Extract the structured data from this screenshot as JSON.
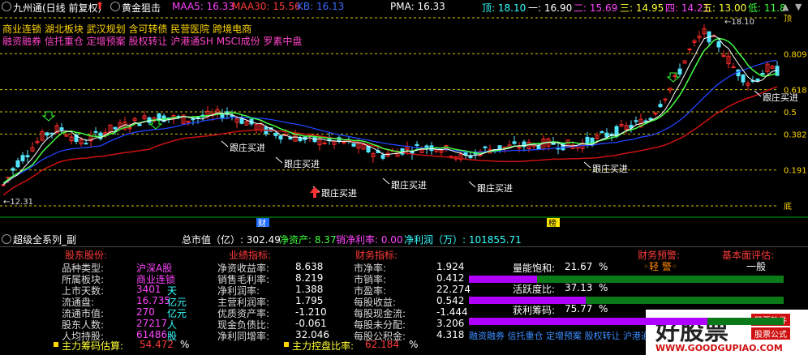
{
  "header": {
    "title": "九州通(日线 前复权)",
    "strategy": "黄金狙击",
    "ma5": "MAA5: 16.33",
    "ma30": "MAA30: 15.56",
    "kb": "KB: 16.13",
    "pma": "PMA: 16.33",
    "top_label": "顶: 18.10",
    "one_label": "一: 16.90",
    "two_label": "二: 15.69",
    "three_label": "三: 14.95",
    "four_label": "四: 14.21",
    "five_label": "五: 13.00",
    "low_label": "低: 11.8"
  },
  "concepts": {
    "line1": "商业连锁 湖北板块 武汉规划 含可转债 民营医院 跨境电商",
    "line2": "融资融券 信托重仓 定增预案 股权转让 沪港通SH MSCI成份 罗素中盘"
  },
  "chart": {
    "right_levels": [
      "顶",
      "0.809",
      "0.618",
      "0.5",
      "0.382",
      "0.191",
      "底"
    ],
    "high_label": "18.10",
    "low_label": "12.31",
    "markers": [
      "跟庄买进",
      "跟庄买进",
      "跟庄买进",
      "跟庄买进",
      "跟庄买进",
      "跟庄买进",
      "跟庄买进"
    ],
    "finance_marker": "财",
    "board_marker": "榜",
    "colors": {
      "up": "#ff2a2a",
      "down": "#55e6ff",
      "ma_white": "#ffffff",
      "ma_yellow": "#ffff33",
      "ma_green": "#44ff44",
      "ma_blue": "#2244ff",
      "ma_red": "#cc1111",
      "fib": "#d4c800"
    }
  },
  "subheader": {
    "name": "超级全系列_副",
    "market_cap": "总市值（亿）: 302.49",
    "net_asset": "净资产: 8.37",
    "sales_margin": "销净利率: 0.00",
    "net_profit": "净利润（万）: 101855.71"
  },
  "panel": {
    "section_titles": {
      "stock": "股东股份:",
      "performance": "业绩指标:",
      "finance": "财务指标:",
      "warning": "财务预警:",
      "basic": "基本面评估:"
    },
    "stock_rows": [
      {
        "label": "品种类型:",
        "value": "沪深A股",
        "unit": ""
      },
      {
        "label": "所属板块:",
        "value": "商业连锁",
        "unit": ""
      },
      {
        "label": "上市天数:",
        "value": "3401",
        "unit": "天"
      },
      {
        "label": "流通盘:",
        "value": "16.735",
        "unit": "亿元"
      },
      {
        "label": "流通市值:",
        "value": "270",
        "unit": "亿元"
      },
      {
        "label": "股东人数:",
        "value": "27217",
        "unit": "人"
      },
      {
        "label": "人均持股:",
        "value": "61486",
        "unit": "股"
      }
    ],
    "perf_rows": [
      {
        "label": "净资收益率:",
        "value": "8.638"
      },
      {
        "label": "销售毛利率:",
        "value": "8.219"
      },
      {
        "label": "净利润率:",
        "value": "1.388"
      },
      {
        "label": "主营利润率:",
        "value": "1.795"
      },
      {
        "label": "优质资产率:",
        "value": "-1.210"
      },
      {
        "label": "现金负债比:",
        "value": "-0.061"
      },
      {
        "label": "净利同增率:",
        "value": "32.046"
      }
    ],
    "fin_rows": [
      {
        "label": "市净率:",
        "value": "1.924"
      },
      {
        "label": "市销率:",
        "value": "0.412"
      },
      {
        "label": "市盈率:",
        "value": "22.274"
      },
      {
        "label": "每股收益:",
        "value": "0.542"
      },
      {
        "label": "每股现金流:",
        "value": "-1.444"
      },
      {
        "label": "每股未分配:",
        "value": "3.206"
      },
      {
        "label": "每股公积金:",
        "value": "4.318"
      }
    ],
    "warning_value": "◦轻 警◦",
    "basic_value": "一般",
    "meters": [
      {
        "label": "量能饱和:",
        "value": "21.67",
        "unit": "%",
        "fraction": 0.2167
      },
      {
        "label": "活跃度比:",
        "value": "37.13",
        "unit": "%",
        "fraction": 0.3713
      },
      {
        "label": "获利筹码:",
        "value": "75.77",
        "unit": "%",
        "fraction": 0.7577
      }
    ],
    "bottom_concepts": "融资融券 信托重仓 定增预案 股权转让 沪港通SH",
    "chip_label": "主力筹码估算:",
    "chip_value": "54.472",
    "chip_unit": "%",
    "control_label": "主力控盘比率:",
    "control_value": "62.184",
    "control_unit": "%"
  },
  "watermark": {
    "text": "好股票",
    "tag1": "股票软件",
    "tag2": "股票公式",
    "url": "WWW.GOODGUPIAO.COM"
  }
}
